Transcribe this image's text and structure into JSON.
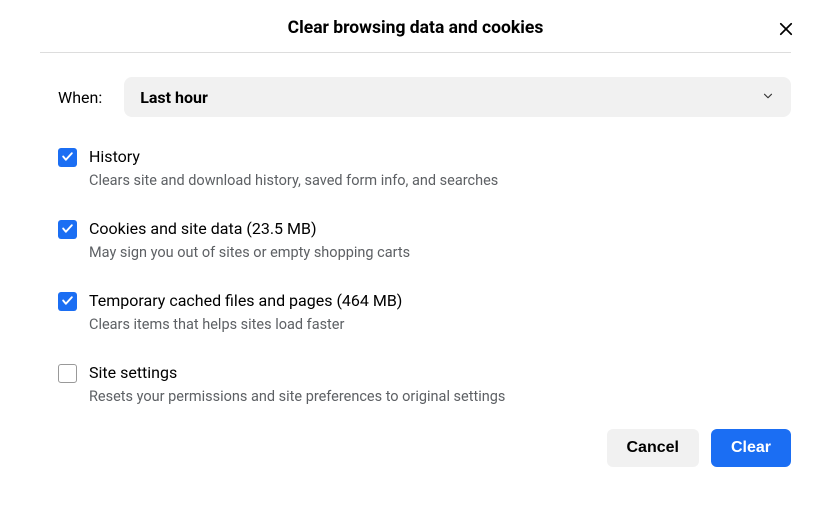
{
  "dialog": {
    "title": "Clear browsing data and cookies",
    "when_label": "When:",
    "when_selected": "Last hour",
    "options": [
      {
        "key": "history",
        "checked": true,
        "label": "History",
        "description": "Clears site and download history, saved form info, and searches"
      },
      {
        "key": "cookies",
        "checked": true,
        "label": "Cookies and site data (23.5 MB)",
        "description": "May sign you out of sites or empty shopping carts"
      },
      {
        "key": "cache",
        "checked": true,
        "label": "Temporary cached files and pages (464 MB)",
        "description": "Clears items that helps sites load faster"
      },
      {
        "key": "site-settings",
        "checked": false,
        "label": "Site settings",
        "description": "Resets your permissions and site preferences to original settings"
      }
    ],
    "cancel_label": "Cancel",
    "clear_label": "Clear"
  }
}
